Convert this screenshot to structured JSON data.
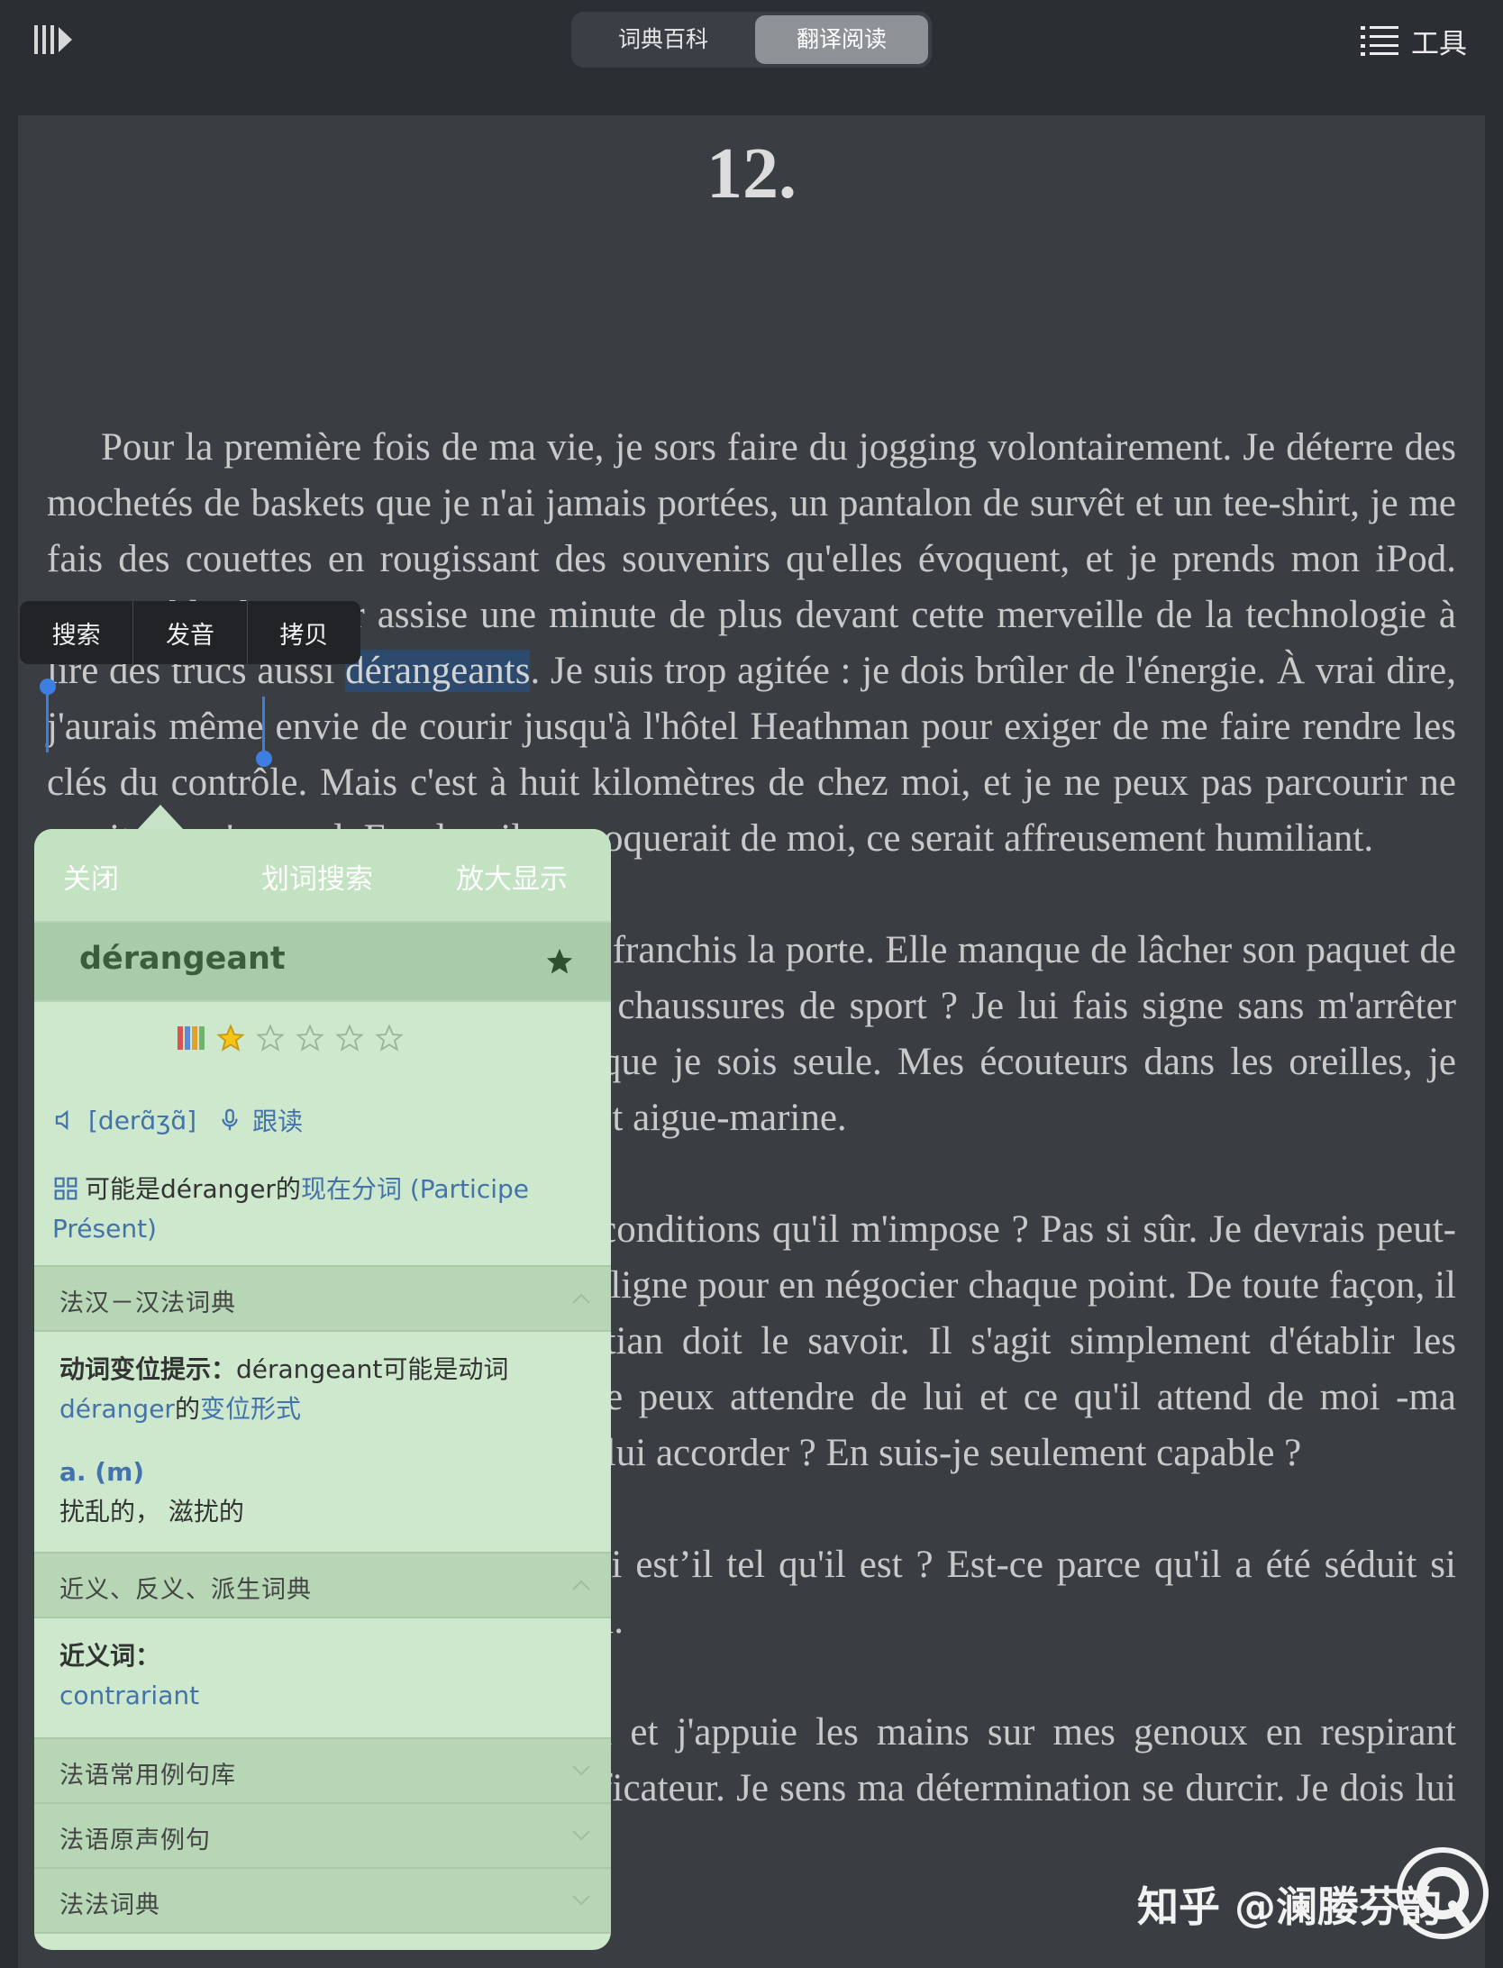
{
  "toolbar": {
    "library_icon": "library-icon",
    "tab_dictionary": "词典百科",
    "tab_translate": "翻译阅读",
    "menu_icon": "list-icon",
    "tools_label": "工具"
  },
  "book": {
    "chapter": "12.",
    "p1_before": "Pour la première fois de ma vie, je sors faire du jogging volontairement. Je déterre des mochetés de baskets que je n'ai jamais portées, un pantalon de survêt et un tee-shirt, je me fais des couettes en rougissant des souvenirs qu'elles évoquent, et je prends mon iPod. Impossible de rester assise une minute de plus devant cette merveille de la technologie à lire des trucs aussi ",
    "p1_selected": "dérangeants",
    "p1_after": ". Je suis trop agitée : je dois brûler de l'énergie. À vrai dire, j'aurais même envie de courir jusqu'à l'hôtel Heathman pour exiger de me faire rendre les clés du contrôle. Mais c'est à huit kilomètres de chez moi, et je ne peux pas parcourir ne serait-ce qu'un seul. En plus, il se moquerait de moi, ce serait affreusement humiliant.",
    "p2": "Kate est dans la cuisine alors que je franchis la porte. Elle manque de lâcher son paquet de chips en me voyant. Ana Steele en chaussures de sport ? Je lui fais signe sans m'arrêter pour subir son inquisition. Il faut que je sois seule. Mes écouteurs dans les oreilles, je m'éloigne dans le crépuscule opale et aigue-marine.",
    "p3": "Est-ce que je veux le voir dans les conditions qu'il m'impose ? Pas si sûr. Je devrais peut-être relire ce contrat ridicule ligne à ligne pour en négocier chaque point. De toute façon, il n'a aucune valeur juridique. Christian doit le savoir. Il s'agit simplement d'établir les paramètres de la relation, ce que je peux attendre de lui et ce qu'il attend de moi -ma soumission totale. Suis-je prête à la lui accorder ? En suis-je seulement capable ?",
    "p4": "Une question me taraude : pourquoi est’il tel qu'il est ? Est-ce parce qu'il a été séduit si jeune ? Il reste une énigme pour moi.",
    "p5": "Je m'arrête près d'un grand épicéa et j'appuie les mains sur mes genoux en respirant profondément. Que c'est bon... purificateur. Je sens ma détermination se durcir. Je dois lui préciser ce qui me convient."
  },
  "context_menu": {
    "search": "搜索",
    "pronounce": "发音",
    "copy": "拷贝"
  },
  "popup": {
    "close": "关闭",
    "lookup": "划词搜索",
    "zoom": "放大显示",
    "word": "dérangeant",
    "rating": 1,
    "rating_max": 5,
    "phonetic": "[derɑ̃ʒɑ̃]",
    "follow_read": "跟读",
    "possible_prefix": "可能是déranger的",
    "possible_link": "现在分词 (Participe Présent)",
    "section_dict": "法汉－汉法词典",
    "conj_label": "动词变位提示：",
    "conj_text": "dérangeant可能是动词",
    "conj_link_verb": "déranger",
    "conj_mid": "的",
    "conj_link_form": "变位形式",
    "pos": "a. (m)",
    "meaning": "扰乱的， 滋扰的",
    "section_syn": "近义、反义、派生词典",
    "syn_label": "近义词：",
    "syn_word": "contrariant",
    "section_examples": "法语常用例句库",
    "section_audio": "法语原声例句",
    "section_fr": "法法词典"
  },
  "watermark": "知乎 @澜媵芬韵",
  "colors": {
    "accent": "#3d7fe0",
    "popup_bg": "#cde8cd",
    "link": "#4472aa",
    "star": "#f5c518"
  }
}
